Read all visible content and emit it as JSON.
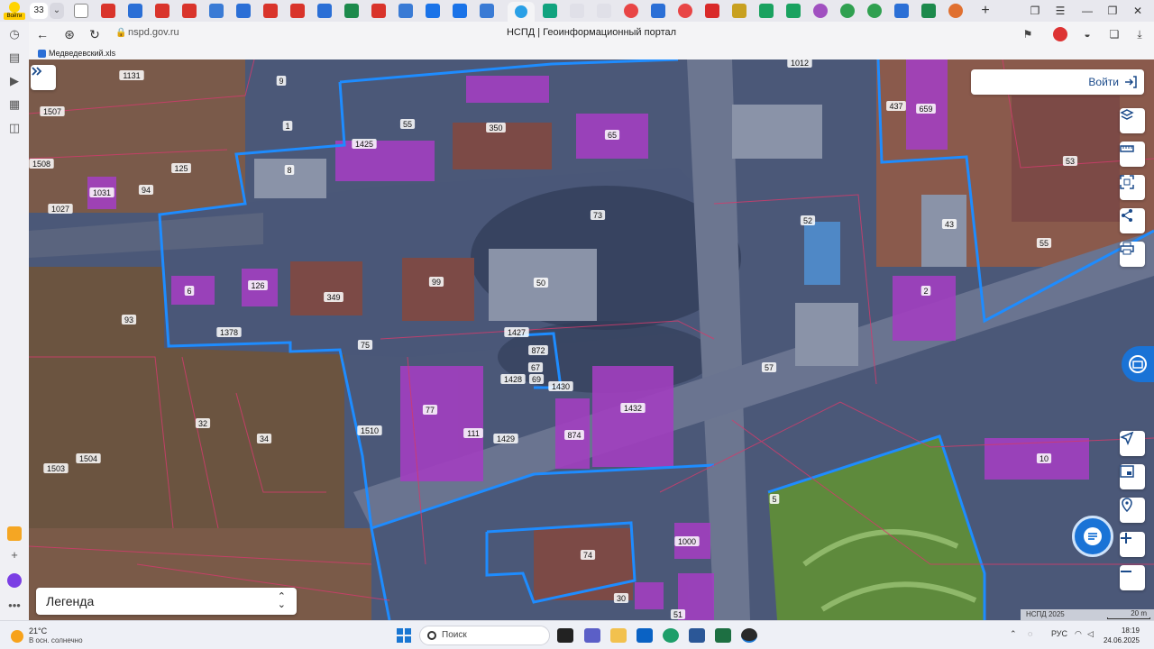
{
  "browser": {
    "tab_count": "33",
    "login_badge": "Войти",
    "url": "nspd.gov.ru",
    "page_title": "НСПД | Геоинформационный портал",
    "bookmark": "Медведевский.xls"
  },
  "map": {
    "login_label": "Войти",
    "legend_label": "Легенда",
    "attribution": "НСПД 2025",
    "scale_label": "20 m",
    "parcels": [
      {
        "n": "1131"
      },
      {
        "n": "9"
      },
      {
        "n": "1507"
      },
      {
        "n": "1"
      },
      {
        "n": "55"
      },
      {
        "n": "350"
      },
      {
        "n": "65"
      },
      {
        "n": "1012"
      },
      {
        "n": "437"
      },
      {
        "n": "659"
      },
      {
        "n": "1425"
      },
      {
        "n": "8"
      },
      {
        "n": "125"
      },
      {
        "n": "1508"
      },
      {
        "n": "94"
      },
      {
        "n": "1031"
      },
      {
        "n": "1027"
      },
      {
        "n": "53"
      },
      {
        "n": "73"
      },
      {
        "n": "52"
      },
      {
        "n": "43"
      },
      {
        "n": "55"
      },
      {
        "n": "6"
      },
      {
        "n": "126"
      },
      {
        "n": "349"
      },
      {
        "n": "99"
      },
      {
        "n": "50"
      },
      {
        "n": "93"
      },
      {
        "n": "2"
      },
      {
        "n": "1378"
      },
      {
        "n": "75"
      },
      {
        "n": "1427"
      },
      {
        "n": "872"
      },
      {
        "n": "67"
      },
      {
        "n": "1428"
      },
      {
        "n": "69"
      },
      {
        "n": "1430"
      },
      {
        "n": "57"
      },
      {
        "n": "77"
      },
      {
        "n": "1432"
      },
      {
        "n": "32"
      },
      {
        "n": "1510"
      },
      {
        "n": "34"
      },
      {
        "n": "111"
      },
      {
        "n": "1429"
      },
      {
        "n": "874"
      },
      {
        "n": "1503"
      },
      {
        "n": "1504"
      },
      {
        "n": "10"
      },
      {
        "n": "5"
      },
      {
        "n": "1000"
      },
      {
        "n": "74"
      },
      {
        "n": "30"
      },
      {
        "n": "51"
      }
    ]
  },
  "taskbar": {
    "temperature": "21°C",
    "weather": "В осн. солнечно",
    "search_placeholder": "Поиск",
    "lang": "РУС",
    "time": "18:19",
    "date": "24.06.2025"
  }
}
